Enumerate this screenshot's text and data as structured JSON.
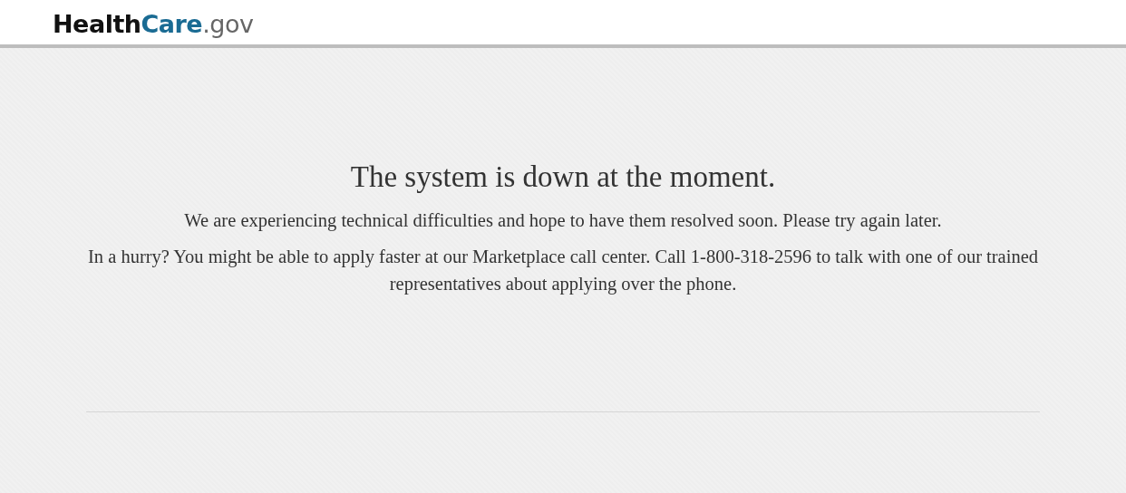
{
  "header": {
    "logo": [
      {
        "text": "Health",
        "color": "#111111"
      },
      {
        "text": "Care",
        "color": "#1a6b93"
      },
      {
        "text": ".gov",
        "color": "#666666"
      }
    ]
  },
  "message": {
    "title": "The system is down at the moment.",
    "paragraphs": [
      "We are experiencing technical difficulties and hope to have them resolved soon. Please try again later.",
      "In a hurry? You might be able to apply faster at our Marketplace call center. Call 1-800-318-2596 to talk with one of our trained representatives about applying over the phone."
    ]
  }
}
